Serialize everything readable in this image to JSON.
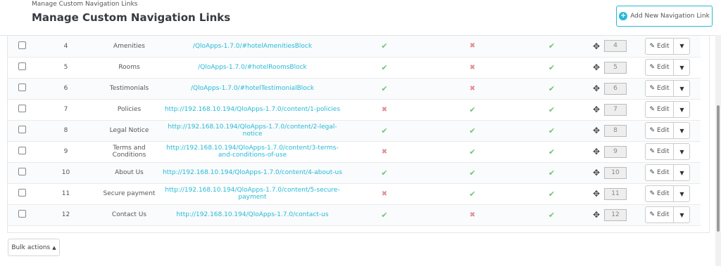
{
  "header": {
    "breadcrumb": "Manage Custom Navigation Links",
    "title": "Manage Custom Navigation Links",
    "add_button_label": "Add New Navigation Link"
  },
  "rows": [
    {
      "id": "4",
      "name": "Amenities",
      "link": "/QloApps-1.7.0/#hotelAmenitiesBlock",
      "col1": "ok",
      "col2": "no",
      "col3": "ok",
      "position": "4",
      "action": "Edit"
    },
    {
      "id": "5",
      "name": "Rooms",
      "link": "/QloApps-1.7.0/#hotelRoomsBlock",
      "col1": "ok",
      "col2": "no",
      "col3": "ok",
      "position": "5",
      "action": "Edit"
    },
    {
      "id": "6",
      "name": "Testimonials",
      "link": "/QloApps-1.7.0/#hotelTestimonialBlock",
      "col1": "ok",
      "col2": "no",
      "col3": "ok",
      "position": "6",
      "action": "Edit"
    },
    {
      "id": "7",
      "name": "Policies",
      "link": "http://192.168.10.194/QloApps-1.7.0/content/1-policies",
      "col1": "no",
      "col2": "ok",
      "col3": "ok",
      "position": "7",
      "action": "Edit"
    },
    {
      "id": "8",
      "name": "Legal Notice",
      "link": "http://192.168.10.194/QloApps-1.7.0/content/2-legal-notice",
      "col1": "ok",
      "col2": "ok",
      "col3": "ok",
      "position": "8",
      "action": "Edit"
    },
    {
      "id": "9",
      "name": "Terms and Conditions",
      "link": "http://192.168.10.194/QloApps-1.7.0/content/3-terms-and-conditions-of-use",
      "col1": "no",
      "col2": "ok",
      "col3": "ok",
      "position": "9",
      "action": "Edit"
    },
    {
      "id": "10",
      "name": "About Us",
      "link": "http://192.168.10.194/QloApps-1.7.0/content/4-about-us",
      "col1": "ok",
      "col2": "ok",
      "col3": "ok",
      "position": "10",
      "action": "Edit"
    },
    {
      "id": "11",
      "name": "Secure payment",
      "link": "http://192.168.10.194/QloApps-1.7.0/content/5-secure-payment",
      "col1": "no",
      "col2": "ok",
      "col3": "ok",
      "position": "11",
      "action": "Edit"
    },
    {
      "id": "12",
      "name": "Contact Us",
      "link": "http://192.168.10.194/QloApps-1.7.0/contact-us",
      "col1": "ok",
      "col2": "no",
      "col3": "ok",
      "position": "12",
      "action": "Edit"
    }
  ],
  "footer": {
    "bulk_actions_label": "Bulk actions"
  },
  "icons": {
    "ok": "check-icon",
    "no": "cross-icon",
    "move": "move-icon",
    "pencil": "pencil-icon"
  },
  "colors": {
    "accent": "#25b9d7",
    "ok": "#72c279",
    "no": "#e08f95"
  }
}
